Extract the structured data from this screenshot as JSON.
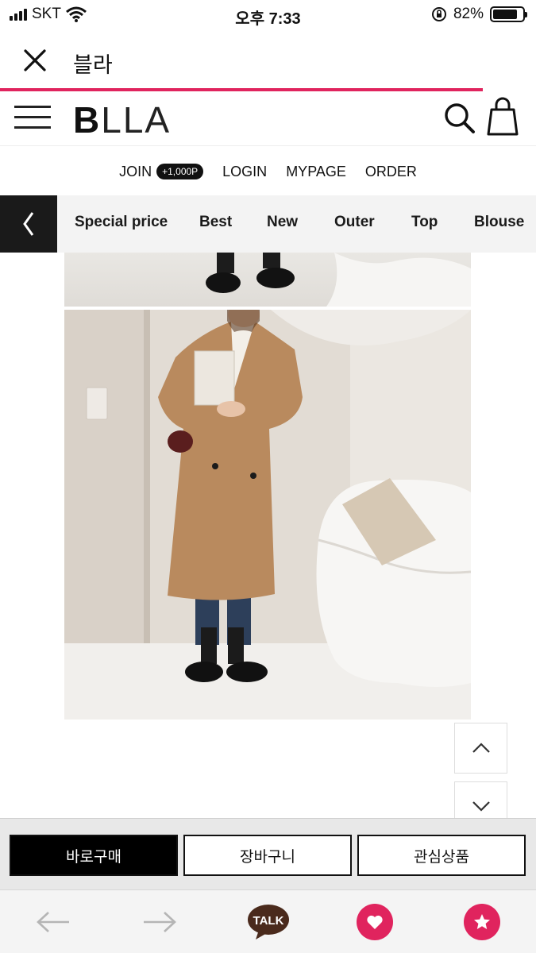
{
  "status_bar": {
    "carrier": "SKT",
    "time": "오후 7:33",
    "battery": "82%",
    "battery_level": 0.82
  },
  "browser": {
    "title": "블라"
  },
  "site": {
    "logo_bold": "B",
    "logo_rest": "LLA",
    "member_links": {
      "join": "JOIN",
      "join_badge": "+1,000P",
      "login": "LOGIN",
      "mypage": "MYPAGE",
      "order": "ORDER"
    },
    "categories": [
      "Special price",
      "Best",
      "New",
      "Outer",
      "Top",
      "Blouse"
    ]
  },
  "actions": {
    "buy_now": "바로구매",
    "cart": "장바구니",
    "wishlist": "관심상품"
  },
  "toolbar": {
    "talk_label": "TALK"
  },
  "colors": {
    "accent": "#e0245e",
    "dark": "#1a1a1a",
    "talk_brown": "#4a2a1c"
  }
}
